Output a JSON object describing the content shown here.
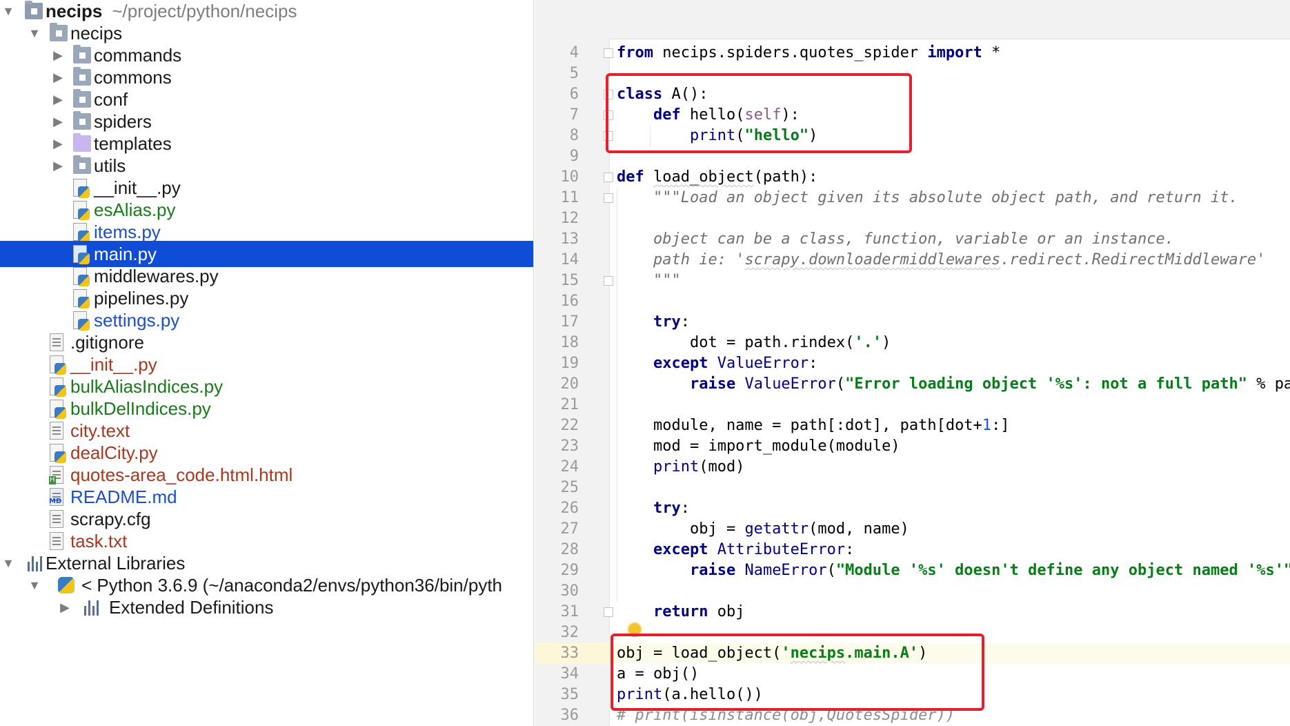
{
  "project_tree": {
    "root": {
      "name": "necips",
      "path": "~/project/python/necips"
    },
    "items": [
      {
        "label": "necips",
        "kind": "folder",
        "arrow": "down"
      },
      {
        "label": "commands",
        "kind": "folder",
        "arrow": "right"
      },
      {
        "label": "commons",
        "kind": "folder",
        "arrow": "right"
      },
      {
        "label": "conf",
        "kind": "folder",
        "arrow": "right"
      },
      {
        "label": "spiders",
        "kind": "folder",
        "arrow": "right"
      },
      {
        "label": "templates",
        "kind": "folder-templates",
        "arrow": "right"
      },
      {
        "label": "utils",
        "kind": "folder",
        "arrow": "right"
      },
      {
        "label": "__init__.py",
        "kind": "python-file"
      },
      {
        "label": "esAlias.py",
        "kind": "python-file",
        "status": "added"
      },
      {
        "label": "items.py",
        "kind": "python-file",
        "status": "modified"
      },
      {
        "label": "main.py",
        "kind": "python-file",
        "selected": true
      },
      {
        "label": "middlewares.py",
        "kind": "python-file"
      },
      {
        "label": "pipelines.py",
        "kind": "python-file"
      },
      {
        "label": "settings.py",
        "kind": "python-file",
        "status": "modified"
      },
      {
        "label": ".gitignore",
        "kind": "text-file"
      },
      {
        "label": "__init__.py",
        "kind": "python-file",
        "status": "unversioned"
      },
      {
        "label": "bulkAliasIndices.py",
        "kind": "python-file",
        "status": "added"
      },
      {
        "label": "bulkDelIndices.py",
        "kind": "python-file",
        "status": "added"
      },
      {
        "label": "city.text",
        "kind": "text-file",
        "status": "unversioned"
      },
      {
        "label": "dealCity.py",
        "kind": "python-file",
        "status": "unversioned"
      },
      {
        "label": "quotes-area_code.html.html",
        "kind": "html-file",
        "status": "unversioned"
      },
      {
        "label": "README.md",
        "kind": "markdown-file",
        "status": "modified"
      },
      {
        "label": "scrapy.cfg",
        "kind": "text-file"
      },
      {
        "label": "task.txt",
        "kind": "text-file",
        "status": "unversioned"
      }
    ],
    "external_libraries": "External Libraries",
    "python_sdk": "< Python 3.6.9 (~/anaconda2/envs/python36/bin/pyth",
    "extended_definitions": "Extended Definitions"
  },
  "editor": {
    "current_line": "33",
    "lines": [
      {
        "n": "4"
      },
      {
        "n": "5"
      },
      {
        "n": "6"
      },
      {
        "n": "7"
      },
      {
        "n": "8"
      },
      {
        "n": "9"
      },
      {
        "n": "10"
      },
      {
        "n": "11"
      },
      {
        "n": "12"
      },
      {
        "n": "13"
      },
      {
        "n": "14"
      },
      {
        "n": "15"
      },
      {
        "n": "16"
      },
      {
        "n": "17"
      },
      {
        "n": "18"
      },
      {
        "n": "19"
      },
      {
        "n": "20"
      },
      {
        "n": "21"
      },
      {
        "n": "22"
      },
      {
        "n": "23"
      },
      {
        "n": "24"
      },
      {
        "n": "25"
      },
      {
        "n": "26"
      },
      {
        "n": "27"
      },
      {
        "n": "28"
      },
      {
        "n": "29"
      },
      {
        "n": "30"
      },
      {
        "n": "31"
      },
      {
        "n": "32"
      },
      {
        "n": "33"
      },
      {
        "n": "34"
      },
      {
        "n": "35"
      },
      {
        "n": "36"
      }
    ],
    "code": {
      "l4": [
        [
          "k",
          "from"
        ],
        [
          "t",
          " necips.spiders.quotes_spider "
        ],
        [
          "k",
          "import"
        ],
        [
          "t",
          " *"
        ]
      ],
      "l6": [
        [
          "k",
          "class"
        ],
        [
          "t",
          " A():"
        ]
      ],
      "l7": [
        [
          "t",
          "    "
        ],
        [
          "k",
          "def"
        ],
        [
          "t",
          " hello("
        ],
        [
          "pa",
          "self"
        ],
        [
          "t",
          "):"
        ]
      ],
      "l8": [
        [
          "t",
          "        "
        ],
        [
          "bi",
          "print"
        ],
        [
          "t",
          "("
        ],
        [
          "s",
          "\"hello\""
        ],
        [
          "t",
          ")"
        ]
      ],
      "l10": [
        [
          "k",
          "def"
        ],
        [
          "t",
          " "
        ],
        [
          "w",
          "load_object"
        ],
        [
          "t",
          "(path):"
        ]
      ],
      "l11": [
        [
          "t",
          "    "
        ],
        [
          "d",
          "\"\"\"Load an object given its absolute object path, and return it."
        ]
      ],
      "l13": [
        [
          "t",
          "    "
        ],
        [
          "d",
          "object can be a class, function, variable or an instance."
        ]
      ],
      "l14": [
        [
          "t",
          "    "
        ],
        [
          "d",
          "path ie: '"
        ],
        [
          "dw",
          "scrapy.downloadermiddlewares"
        ],
        [
          "d",
          ".redirect.RedirectMiddleware'"
        ]
      ],
      "l15": [
        [
          "t",
          "    "
        ],
        [
          "d",
          "\"\"\""
        ]
      ],
      "l17": [
        [
          "t",
          "    "
        ],
        [
          "k",
          "try"
        ],
        [
          "t",
          ":"
        ]
      ],
      "l18": [
        [
          "t",
          "        dot = path.rindex("
        ],
        [
          "s",
          "'.'"
        ],
        [
          "t",
          ")"
        ]
      ],
      "l19": [
        [
          "t",
          "    "
        ],
        [
          "k",
          "except"
        ],
        [
          "t",
          " "
        ],
        [
          "bi",
          "ValueError"
        ],
        [
          "t",
          ":"
        ]
      ],
      "l20": [
        [
          "t",
          "        "
        ],
        [
          "k",
          "raise"
        ],
        [
          "t",
          " "
        ],
        [
          "bi",
          "ValueError"
        ],
        [
          "t",
          "("
        ],
        [
          "s",
          "\"Error loading object '%s': not a full path\""
        ],
        [
          "t",
          " % path)"
        ]
      ],
      "l22": [
        [
          "t",
          "    module, name = path[:dot], path[dot+"
        ],
        [
          "n",
          "1"
        ],
        [
          "t",
          ":]"
        ]
      ],
      "l23": [
        [
          "t",
          "    mod = import_module(module)"
        ]
      ],
      "l24": [
        [
          "t",
          "    "
        ],
        [
          "bi",
          "print"
        ],
        [
          "t",
          "(mod)"
        ]
      ],
      "l26": [
        [
          "t",
          "    "
        ],
        [
          "k",
          "try"
        ],
        [
          "t",
          ":"
        ]
      ],
      "l27": [
        [
          "t",
          "        obj = "
        ],
        [
          "bi",
          "getattr"
        ],
        [
          "t",
          "(mod, name)"
        ]
      ],
      "l28": [
        [
          "t",
          "    "
        ],
        [
          "k",
          "except"
        ],
        [
          "t",
          " "
        ],
        [
          "bi",
          "AttributeError"
        ],
        [
          "t",
          ":"
        ]
      ],
      "l29": [
        [
          "t",
          "        "
        ],
        [
          "k",
          "raise"
        ],
        [
          "t",
          " "
        ],
        [
          "bi",
          "NameError"
        ],
        [
          "t",
          "("
        ],
        [
          "s",
          "\"Module '%s' doesn't define any object named '%s'\""
        ],
        [
          "t",
          ")"
        ]
      ],
      "l31": [
        [
          "t",
          "    "
        ],
        [
          "k",
          "return"
        ],
        [
          "t",
          " obj"
        ]
      ],
      "l33": [
        [
          "t",
          "obj = load_object("
        ],
        [
          "s",
          "'"
        ],
        [
          "sw",
          "necips"
        ],
        [
          "s",
          ".main.A'"
        ],
        [
          "t",
          ")"
        ]
      ],
      "l34": [
        [
          "t",
          "a = obj()"
        ]
      ],
      "l35": [
        [
          "bi",
          "print"
        ],
        [
          "t",
          "(a.hello())"
        ]
      ],
      "l36": [
        [
          "cm",
          "# print(isinstance(obj,QuotesSpider))"
        ]
      ]
    }
  },
  "annotations": {
    "highlight_color": "#e4202a"
  },
  "colors": {
    "selection": "#0f4dd6",
    "keyword": "#000080",
    "string": "#067d17",
    "docstring": "#707070",
    "number": "#1750eb"
  }
}
